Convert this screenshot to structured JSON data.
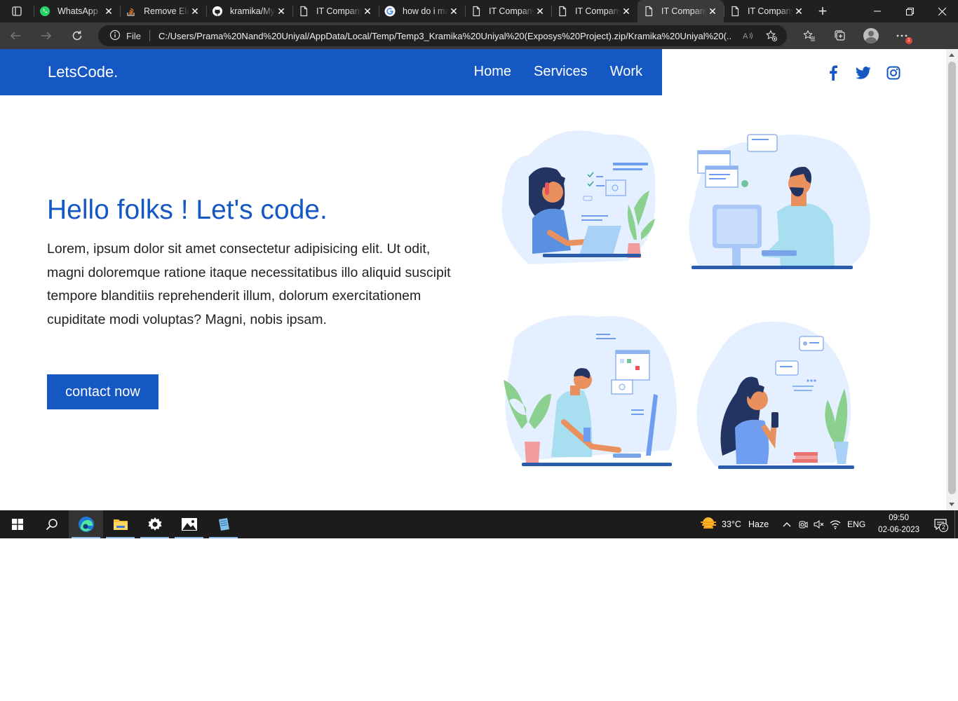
{
  "browser": {
    "tabs": [
      {
        "title": "WhatsApp",
        "icon": "whatsapp-icon",
        "active": false
      },
      {
        "title": "Remove Elements",
        "icon": "stack-overflow-icon",
        "active": false
      },
      {
        "title": "kramika/MyPortfolio",
        "icon": "github-icon",
        "active": false
      },
      {
        "title": "IT Company",
        "icon": "page-icon",
        "active": false
      },
      {
        "title": "how do i make",
        "icon": "google-icon",
        "active": false
      },
      {
        "title": "IT Company",
        "icon": "page-icon",
        "active": false
      },
      {
        "title": "IT Company",
        "icon": "page-icon",
        "active": false
      },
      {
        "title": "IT Company",
        "icon": "page-icon",
        "active": true
      },
      {
        "title": "IT Company",
        "icon": "page-icon",
        "active": false
      }
    ],
    "address": {
      "scheme_label": "File",
      "url": "C:/Users/Prama%20Nand%20Uniyal/AppData/Local/Temp/Temp3_Kramika%20Uniyal%20(Exposys%20Project).zip/Kramika%20Uniyal%20(..."
    },
    "menu_badge": "1"
  },
  "site": {
    "brand": "LetsCode.",
    "nav": [
      "Home",
      "Services",
      "Work"
    ],
    "social": [
      "facebook-icon",
      "twitter-icon",
      "instagram-icon"
    ],
    "hero": {
      "title": "Hello folks ! Let's code.",
      "text": "Lorem, ipsum dolor sit amet consectetur adipisicing elit. Ut odit, magni doloremque ratione itaque necessitatibus illo aliquid suscipit tempore blanditiis reprehenderit illum, dolorum exercitationem cupiditate modi voluptas? Magni, nobis ipsam.",
      "cta": "contact now"
    },
    "colors": {
      "primary": "#1558c4",
      "text": "#222222",
      "blob": "#e4efff"
    }
  },
  "taskbar": {
    "apps": [
      "edge-icon",
      "file-explorer-icon",
      "settings-icon",
      "photos-icon",
      "notepad-icon"
    ],
    "weather": {
      "temp": "33°C",
      "condition": "Haze"
    },
    "language": "ENG",
    "time": "09:50",
    "date": "02-06-2023",
    "notifications": "2"
  }
}
